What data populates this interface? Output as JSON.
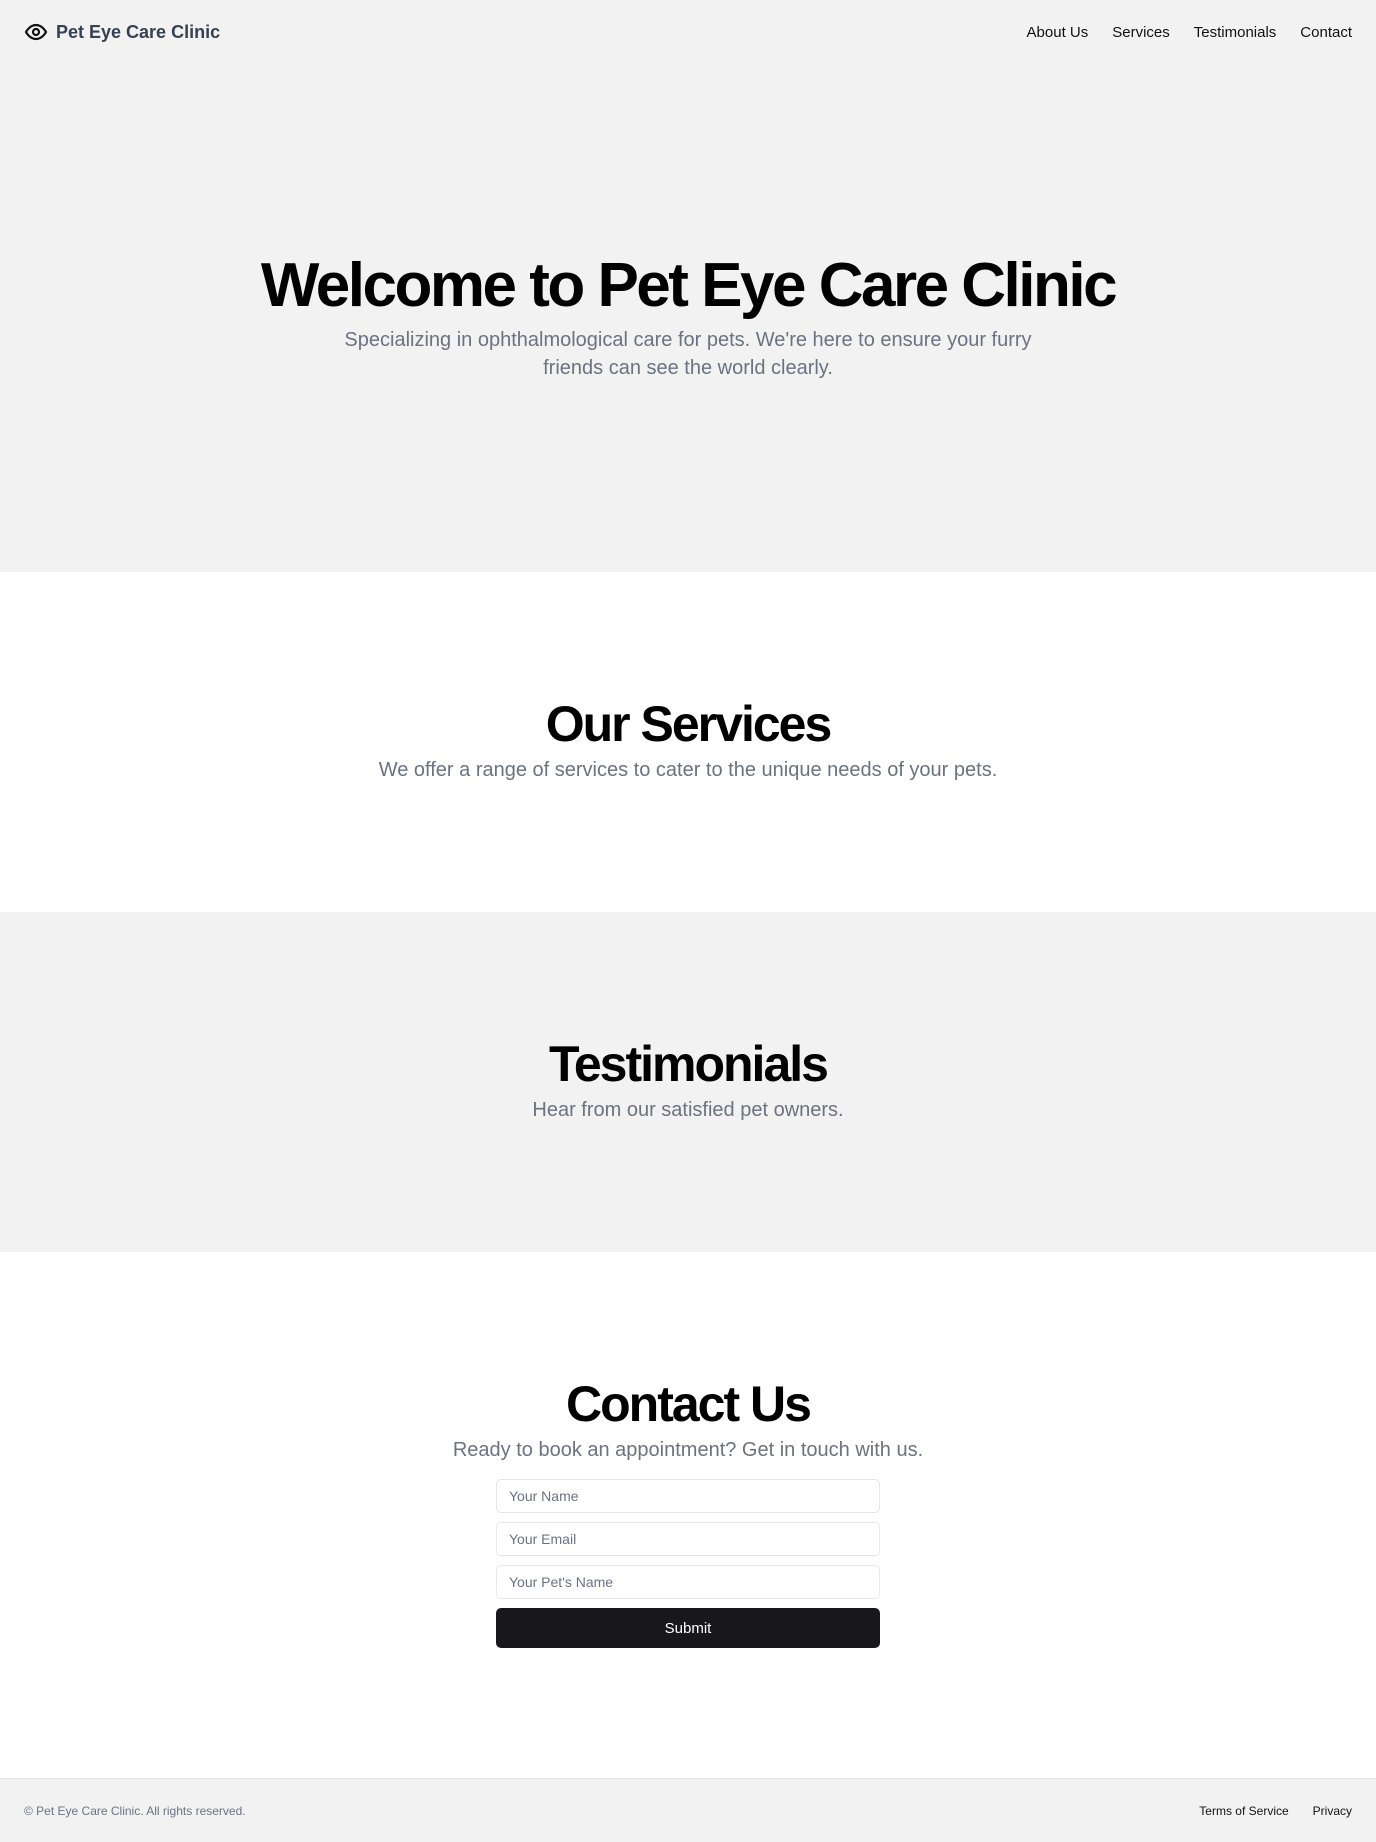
{
  "header": {
    "brand_icon": "eye-icon",
    "brand_name": "Pet Eye Care Clinic",
    "nav": [
      "About Us",
      "Services",
      "Testimonials",
      "Contact"
    ]
  },
  "hero": {
    "title": "Welcome to Pet Eye Care Clinic",
    "subtitle": "Specializing in ophthalmological care for pets. We're here to ensure your furry friends can see the world clearly."
  },
  "services": {
    "title": "Our Services",
    "subtitle": "We offer a range of services to cater to the unique needs of your pets."
  },
  "testimonials": {
    "title": "Testimonials",
    "subtitle": "Hear from our satisfied pet owners."
  },
  "contact": {
    "title": "Contact Us",
    "subtitle": "Ready to book an appointment? Get in touch with us.",
    "name_placeholder": "Your Name",
    "email_placeholder": "Your Email",
    "pet_placeholder": "Your Pet's Name",
    "submit_label": "Submit"
  },
  "footer": {
    "copyright": "© Pet Eye Care Clinic. All rights reserved.",
    "links": [
      "Terms of Service",
      "Privacy"
    ]
  },
  "colors": {
    "band_background": "#f2f2f2",
    "muted_text": "#6b7280",
    "button_background": "#18181b"
  }
}
